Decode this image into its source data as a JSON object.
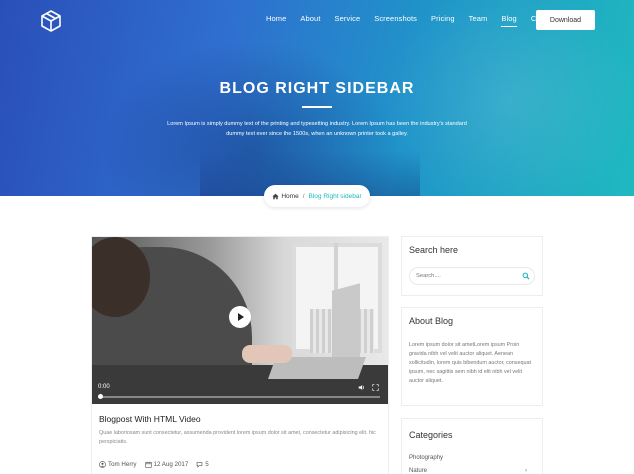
{
  "nav": {
    "items": [
      "Home",
      "About",
      "Service",
      "Screenshots",
      "Pricing",
      "Team",
      "Blog",
      "Contact"
    ],
    "active_index": 6,
    "download_label": "Download"
  },
  "hero": {
    "title": "BLOG RIGHT SIDEBAR",
    "description": "Lorem Ipsum is simply dummy text of the printing and typesetting industry. Lorem Ipsum has been the industry's standard dummy text ever since the 1500s, when an unknown printer took a galley."
  },
  "breadcrumb": {
    "home": "Home",
    "separator": "/",
    "current": "Blog Right sidebar"
  },
  "post": {
    "video_time": "0:00",
    "title": "Blogpost With HTML Video",
    "excerpt": "Quae laboriosam sunt consectetur, assumenda provident lorem ipsum dolor sit amet, consectetur adipisicing elit. hic perspiciatis.",
    "author": "Tom Herry",
    "date": "12 Aug 2017",
    "comments": "5"
  },
  "sidebar": {
    "search": {
      "title": "Search here",
      "placeholder": "Search....",
      "value": ""
    },
    "about": {
      "title": "About Blog",
      "text": "Lorem ipsum dolor sit ametLorem ipsum Proin gravida nibh vel velit auctor aliquet. Aenean sollicitudin, lorem quis bibendum auctor, consequat ipsum, nec sagittis sem nibh id elit nibh vel velit auctor aliquet."
    },
    "categories": {
      "title": "Categories",
      "items": [
        "Photography",
        "Nature"
      ]
    }
  },
  "colors": {
    "accent": "#1fb9bf",
    "hero_start": "#2a4fb8",
    "hero_end": "#1fb9bf"
  }
}
